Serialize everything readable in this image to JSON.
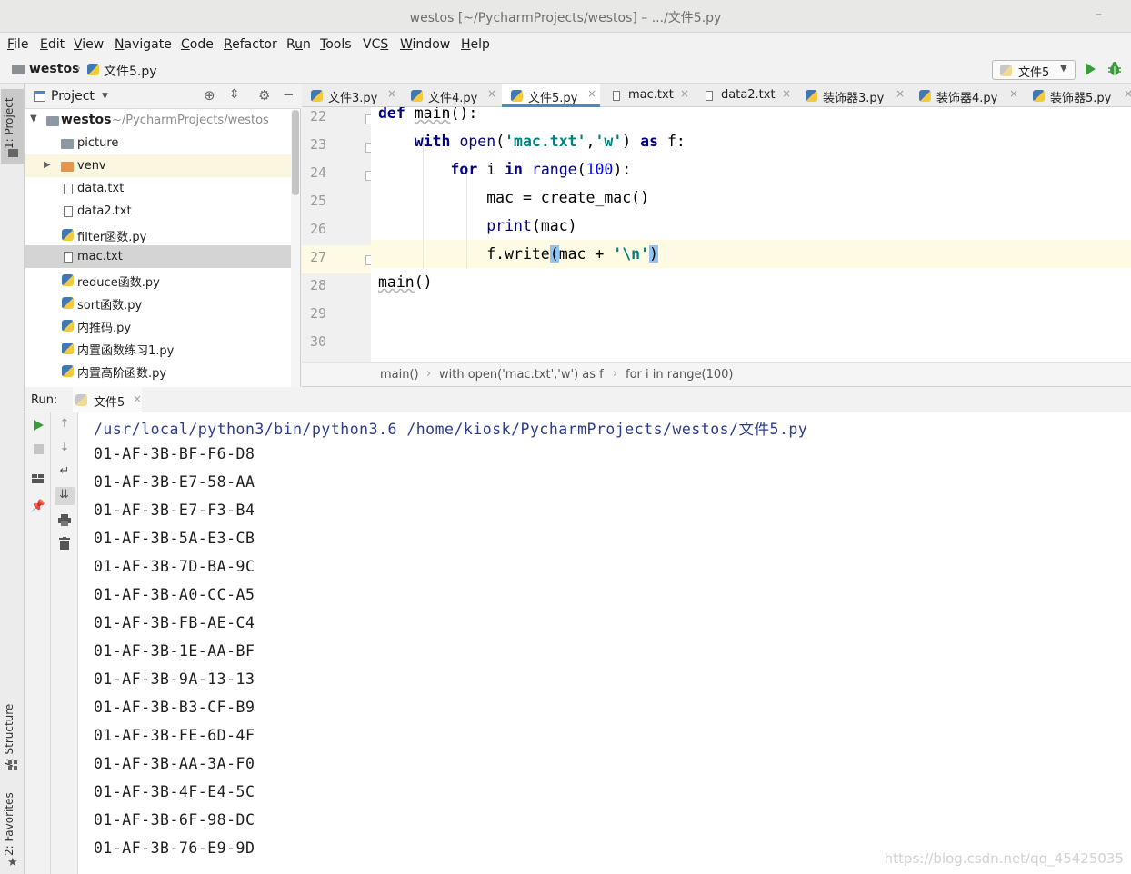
{
  "window": {
    "title": "westos [~/PycharmProjects/westos] – .../文件5.py",
    "minimize_glyph": "–"
  },
  "menu": [
    "File",
    "Edit",
    "View",
    "Navigate",
    "Code",
    "Refactor",
    "Run",
    "Tools",
    "VCS",
    "Window",
    "Help"
  ],
  "menu_mnemonics": [
    "F",
    "E",
    "V",
    "N",
    "C",
    "R",
    "u",
    "T",
    "S",
    "W",
    "H"
  ],
  "navbar": {
    "project": "westos",
    "file": "文件5.py",
    "run_config": "文件5"
  },
  "side_tabs": {
    "project": "1: Project",
    "structure": "7: Structure",
    "favorites": "2: Favorites"
  },
  "project_panel": {
    "title": "Project",
    "root_name": "westos",
    "root_path": "~/PycharmProjects/westos",
    "items": [
      {
        "name": "picture",
        "kind": "folder"
      },
      {
        "name": "venv",
        "kind": "folder-orange"
      },
      {
        "name": "data.txt",
        "kind": "text"
      },
      {
        "name": "data2.txt",
        "kind": "text"
      },
      {
        "name": "filter函数.py",
        "kind": "python"
      },
      {
        "name": "mac.txt",
        "kind": "text"
      },
      {
        "name": "reduce函数.py",
        "kind": "python"
      },
      {
        "name": "sort函数.py",
        "kind": "python"
      },
      {
        "name": "内推码.py",
        "kind": "python"
      },
      {
        "name": "内置函数练习1.py",
        "kind": "python"
      },
      {
        "name": "内置高阶函数.py",
        "kind": "python"
      }
    ],
    "selected": "mac.txt"
  },
  "tabs": [
    {
      "label": "文件3.py",
      "kind": "python"
    },
    {
      "label": "文件4.py",
      "kind": "python"
    },
    {
      "label": "文件5.py",
      "kind": "python",
      "active": true
    },
    {
      "label": "mac.txt",
      "kind": "text"
    },
    {
      "label": "data2.txt",
      "kind": "text"
    },
    {
      "label": "装饰器3.py",
      "kind": "python"
    },
    {
      "label": "装饰器4.py",
      "kind": "python"
    },
    {
      "label": "装饰器5.py",
      "kind": "python"
    }
  ],
  "editor": {
    "line_numbers": [
      "22",
      "23",
      "24",
      "25",
      "26",
      "27",
      "28",
      "29",
      "30"
    ],
    "current_line": "27"
  },
  "breadcrumbs": [
    "main()",
    "with open('mac.txt','w') as f",
    "for i in range(100)"
  ],
  "run_panel": {
    "label": "Run:",
    "config_tab": "文件5",
    "command": "/usr/local/python3/bin/python3.6 /home/kiosk/PycharmProjects/westos/文件5.py",
    "output": [
      "01-AF-3B-BF-F6-D8",
      "01-AF-3B-E7-58-AA",
      "01-AF-3B-E7-F3-B4",
      "01-AF-3B-5A-E3-CB",
      "01-AF-3B-7D-BA-9C",
      "01-AF-3B-A0-CC-A5",
      "01-AF-3B-FB-AE-C4",
      "01-AF-3B-1E-AA-BF",
      "01-AF-3B-9A-13-13",
      "01-AF-3B-B3-CF-B9",
      "01-AF-3B-FE-6D-4F",
      "01-AF-3B-AA-3A-F0",
      "01-AF-3B-4F-E4-5C",
      "01-AF-3B-6F-98-DC",
      "01-AF-3B-76-E9-9D"
    ]
  },
  "watermark": "https://blog.csdn.net/qq_45425035",
  "colors": {
    "accent": "#4a88c7",
    "run_green": "#3b9a3b",
    "selection": "#d4d4d4",
    "keyword": "#000080",
    "string": "#008080"
  }
}
